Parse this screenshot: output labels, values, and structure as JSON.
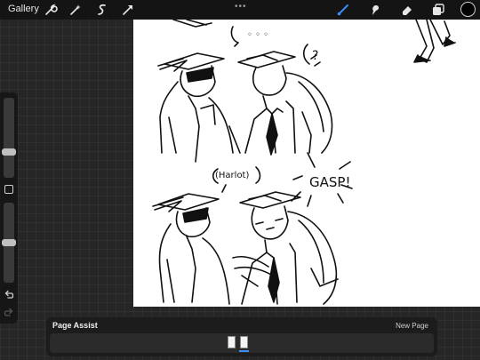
{
  "toolbar": {
    "gallery_label": "Gallery",
    "more_label": "•••",
    "left_tools": [
      "wrench-icon",
      "magic-wand-icon",
      "selection-icon",
      "transform-arrow-icon"
    ],
    "right_tools": [
      "brush-icon",
      "smudge-icon",
      "eraser-icon",
      "layers-icon"
    ],
    "active_tool": "brush-icon",
    "accent_color": "#3a8ef5",
    "current_color": "#000000"
  },
  "sidebar": {
    "brush_size_level": 0.3,
    "opacity_level": 0.5
  },
  "canvas": {
    "speech_top_dots": "◦ ◦ ◦",
    "speech_question": "?",
    "speech_harlot": "(Harlot)",
    "speech_gasp": "GASP!"
  },
  "page_assist": {
    "title": "Page Assist",
    "new_page_label": "New Page",
    "page_count": 2,
    "active_page": 2
  }
}
